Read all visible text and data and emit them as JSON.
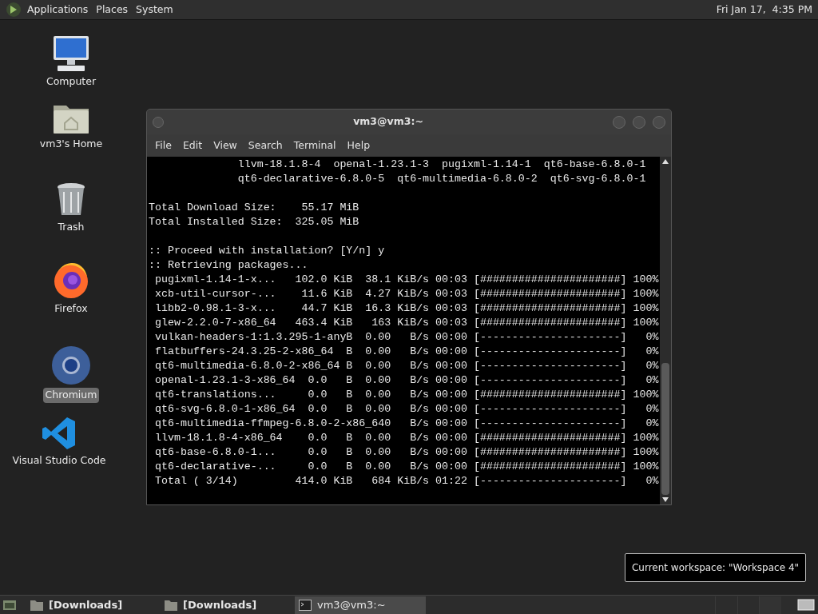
{
  "top_panel": {
    "menus": [
      "Applications",
      "Places",
      "System"
    ],
    "clock": "Fri Jan 17,  4:35 PM"
  },
  "desktop_icons": [
    {
      "label": "Computer",
      "kind": "computer",
      "selected": false
    },
    {
      "label": "vm3's Home",
      "kind": "home",
      "selected": false
    },
    {
      "label": "Trash",
      "kind": "trash",
      "selected": false
    },
    {
      "label": "Firefox",
      "kind": "firefox",
      "selected": false
    },
    {
      "label": "Chromium",
      "kind": "chromium",
      "selected": true
    },
    {
      "label": "Visual Studio Code",
      "kind": "vscode",
      "selected": false
    }
  ],
  "terminal": {
    "title": "vm3@vm3:~",
    "menu": [
      "File",
      "Edit",
      "View",
      "Search",
      "Terminal",
      "Help"
    ],
    "blocks": [
      [
        "              llvm-18.1.8-4  openal-1.23.1-3  pugixml-1.14-1  qt6-base-6.8.0-1",
        "              qt6-declarative-6.8.0-5  qt6-multimedia-6.8.0-2  qt6-svg-6.8.0-1"
      ],
      [
        "Total Download Size:    55.17 MiB",
        "Total Installed Size:  325.05 MiB"
      ],
      [
        ":: Proceed with installation? [Y/n] y",
        ":: Retrieving packages...",
        " pugixml-1.14-1-x...   102.0 KiB  38.1 KiB/s 00:03 [######################] 100%",
        " xcb-util-cursor-...    11.6 KiB  4.27 KiB/s 00:03 [######################] 100%",
        " libb2-0.98.1-3-x...    44.7 KiB  16.3 KiB/s 00:03 [######################] 100%",
        " glew-2.2.0-7-x86_64   463.4 KiB   163 KiB/s 00:03 [######################] 100%",
        " vulkan-headers-1:1.3.295-1-anyB  0.00   B/s 00:00 [----------------------]   0%",
        " flatbuffers-24.3.25-2-x86_64  B  0.00   B/s 00:00 [----------------------]   0%",
        " qt6-multimedia-6.8.0-2-x86_64 B  0.00   B/s 00:00 [----------------------]   0%",
        " openal-1.23.1-3-x86_64  0.0   B  0.00   B/s 00:00 [----------------------]   0%",
        " qt6-translations...     0.0   B  0.00   B/s 00:00 [######################] 100%",
        " qt6-svg-6.8.0-1-x86_64  0.0   B  0.00   B/s 00:00 [----------------------]   0%",
        " qt6-multimedia-ffmpeg-6.8.0-2-x86_640   B/s 00:00 [----------------------]   0%",
        " llvm-18.1.8-4-x86_64    0.0   B  0.00   B/s 00:00 [######################] 100%",
        " qt6-base-6.8.0-1...     0.0   B  0.00   B/s 00:00 [######################] 100%",
        " qt6-declarative-...     0.0   B  0.00   B/s 00:00 [######################] 100%",
        " Total ( 3/14)         414.0 KiB   684 KiB/s 01:22 [----------------------]   0%"
      ]
    ]
  },
  "tooltip": "Current workspace: \"Workspace 4\"",
  "taskbar": [
    {
      "label": "[Downloads]",
      "kind": "folder",
      "selected": false
    },
    {
      "label": "[Downloads]",
      "kind": "folder",
      "selected": false
    },
    {
      "label": "vm3@vm3:~",
      "kind": "terminal",
      "selected": true
    }
  ]
}
